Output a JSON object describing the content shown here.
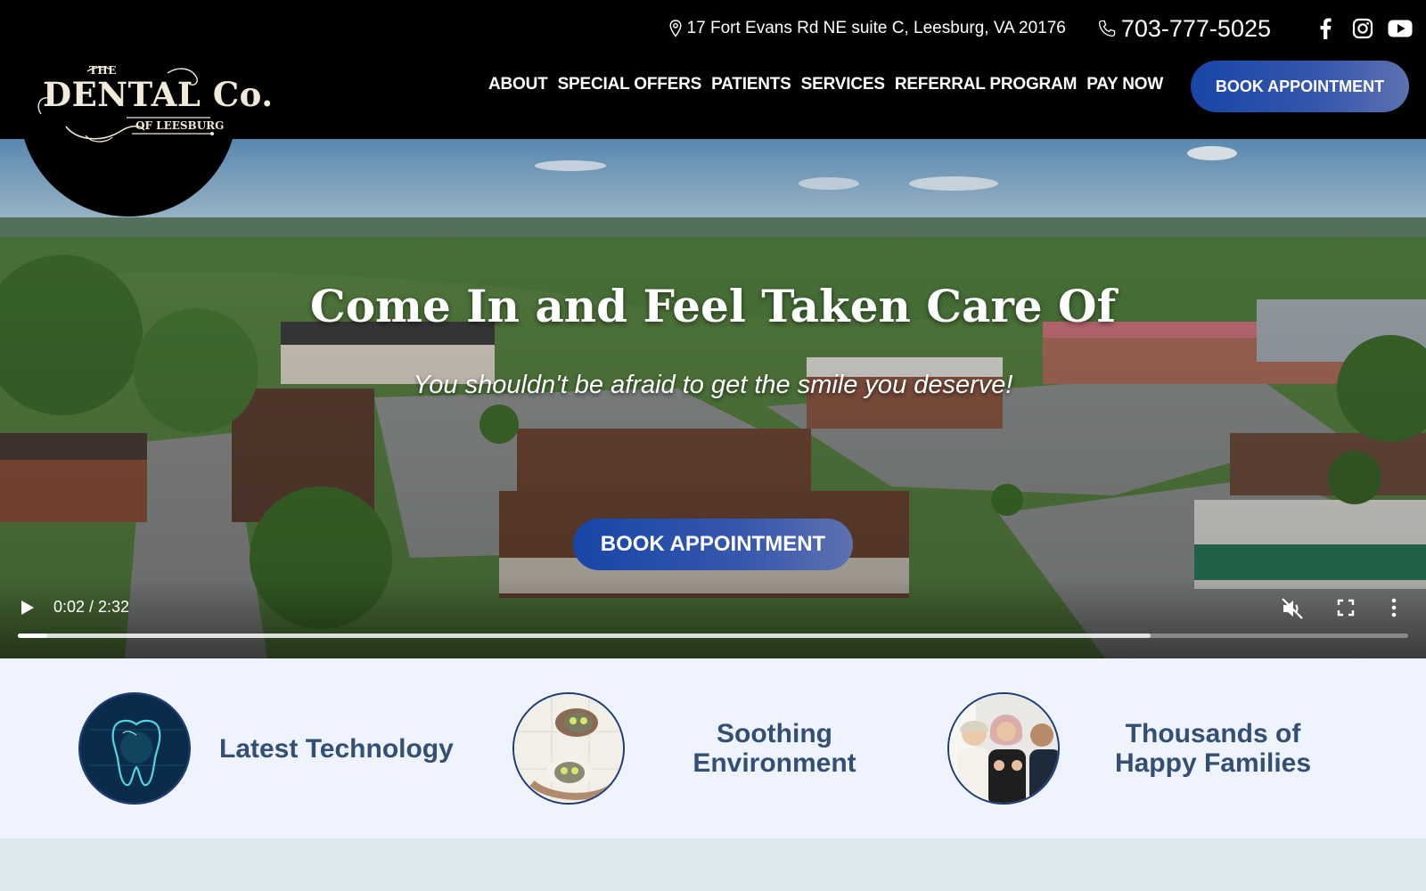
{
  "header": {
    "logo": {
      "the": "THE",
      "main": "DENTAL Co.",
      "sub": "OF LEESBURG"
    },
    "address": "17 Fort Evans Rd NE suite C, Leesburg, VA 20176",
    "phone": "703-777-5025",
    "social_icons": [
      "facebook-icon",
      "instagram-icon",
      "youtube-icon"
    ],
    "nav": [
      "ABOUT",
      "SPECIAL OFFERS",
      "PATIENTS",
      "SERVICES",
      "REFERRAL PROGRAM",
      "PAY NOW"
    ],
    "book_label": "BOOK APPOINTMENT"
  },
  "hero": {
    "title": "Come In and Feel Taken Care Of",
    "subtitle": "You shouldn't be afraid to get the smile you deserve!",
    "book_label": "BOOK APPOINTMENT",
    "video": {
      "time": "0:02 / 2:32",
      "played_fraction": 0.021,
      "buffered_fraction": 0.815,
      "muted": true
    }
  },
  "features": [
    {
      "label_line1": "Latest Technology",
      "label_line2": "",
      "icon": "tooth-technology-image"
    },
    {
      "label_line1": "Soothing",
      "label_line2": "Environment",
      "icon": "spa-facial-image"
    },
    {
      "label_line1": "Thousands of",
      "label_line2": "Happy Families",
      "icon": "happy-family-image"
    }
  ],
  "colors": {
    "header_bg": "#000000",
    "accent_blue": "#1845a8",
    "feature_text": "#344f74",
    "feature_bg": "#eef3fd"
  }
}
